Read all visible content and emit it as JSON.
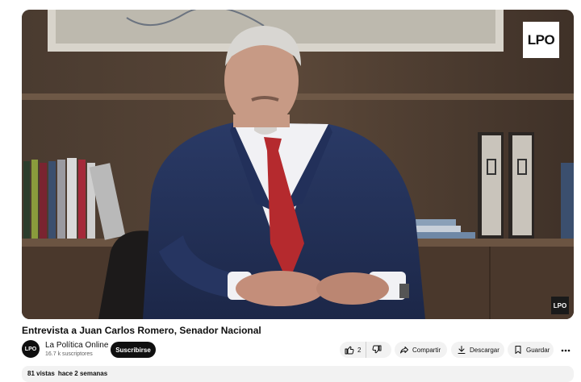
{
  "video": {
    "logo_top": "LPO",
    "logo_corner": "LPO",
    "title": "Entrevista a Juan Carlos Romero, Senador Nacional"
  },
  "channel": {
    "avatar_text": "LPO",
    "name": "La Política Online",
    "subscribers": "16.7 k suscriptores",
    "subscribe_label": "Suscribirse"
  },
  "actions": {
    "like_count": "2",
    "share_label": "Compartir",
    "download_label": "Descargar",
    "save_label": "Guardar"
  },
  "description": {
    "views": "81 vistas",
    "date": "hace 2 semanas"
  },
  "icons": [
    "thumbs-up-icon",
    "thumbs-down-icon",
    "share-icon",
    "download-icon",
    "bookmark-icon",
    "more-icon"
  ]
}
